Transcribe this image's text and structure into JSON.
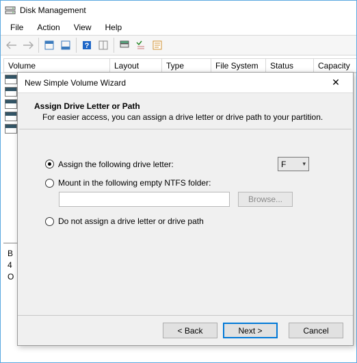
{
  "window": {
    "title": "Disk Management"
  },
  "menu": {
    "file": "File",
    "action": "Action",
    "view": "View",
    "help": "Help"
  },
  "columns": {
    "volume": "Volume",
    "layout": "Layout",
    "type": "Type",
    "filesystem": "File System",
    "status": "Status",
    "capacity": "Capacity"
  },
  "volumes": {
    "row0": "...",
    "row1": "...",
    "row2": "...",
    "row3": "...",
    "row4": "..."
  },
  "lower": {
    "line0": "B",
    "line1": "4",
    "line2": "O"
  },
  "dialog": {
    "title": "New Simple Volume Wizard",
    "heading": "Assign Drive Letter or Path",
    "subheading": "For easier access, you can assign a drive letter or drive path to your partition.",
    "opt_assign": "Assign the following drive letter:",
    "drive_letter": "F",
    "opt_mount": "Mount in the following empty NTFS folder:",
    "browse": "Browse...",
    "opt_none": "Do not assign a drive letter or drive path",
    "back": "< Back",
    "next": "Next >",
    "cancel": "Cancel"
  }
}
